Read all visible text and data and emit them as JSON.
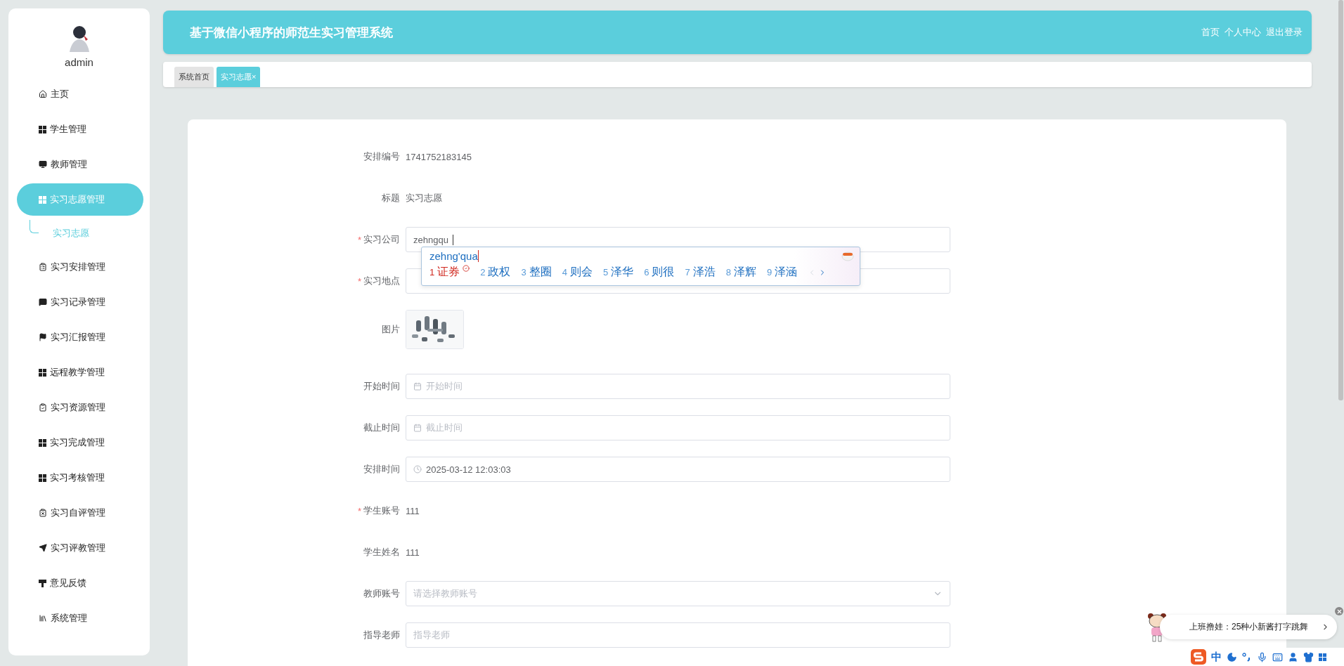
{
  "sidebar": {
    "user": "admin",
    "items": [
      {
        "label": "主页",
        "selected": false
      },
      {
        "label": "学生管理",
        "selected": false
      },
      {
        "label": "教师管理",
        "selected": false
      },
      {
        "label": "实习志愿管理",
        "selected": true,
        "children": [
          {
            "label": "实习志愿",
            "selected": true
          }
        ]
      },
      {
        "label": "实习安排管理",
        "selected": false
      },
      {
        "label": "实习记录管理",
        "selected": false
      },
      {
        "label": "实习汇报管理",
        "selected": false
      },
      {
        "label": "远程教学管理",
        "selected": false
      },
      {
        "label": "实习资源管理",
        "selected": false
      },
      {
        "label": "实习完成管理",
        "selected": false
      },
      {
        "label": "实习考核管理",
        "selected": false
      },
      {
        "label": "实习自评管理",
        "selected": false
      },
      {
        "label": "实习评教管理",
        "selected": false
      },
      {
        "label": "意见反馈",
        "selected": false
      },
      {
        "label": "系统管理",
        "selected": false
      }
    ]
  },
  "header": {
    "title": "基于微信小程序的师范生实习管理系统",
    "links": [
      "首页",
      "个人中心",
      "退出登录"
    ]
  },
  "tabs": [
    {
      "label": "系统首页",
      "selected": false
    },
    {
      "label": "实习志愿",
      "selected": true,
      "close": "×"
    }
  ],
  "form": {
    "fields": [
      {
        "kind": "static",
        "label": "安排编号",
        "value": "1741752183145"
      },
      {
        "kind": "static",
        "label": "标题",
        "value": "实习志愿"
      },
      {
        "kind": "input",
        "label": "实习公司",
        "required_mark": "*",
        "value": "zehngqu",
        "focused": true
      },
      {
        "kind": "input",
        "label": "实习地点",
        "required_mark": "*"
      },
      {
        "label": "图片"
      },
      {
        "kind": "date",
        "label": "开始时间",
        "placeholder": "开始时间"
      },
      {
        "kind": "date",
        "label": "截止时间",
        "placeholder": "截止时间"
      },
      {
        "kind": "datetime",
        "label": "安排时间",
        "value": "2025-03-12 12:03:03"
      },
      {
        "kind": "static",
        "label": "学生账号",
        "required_mark": "*",
        "value": "111"
      },
      {
        "kind": "static",
        "label": "学生姓名",
        "value": "111"
      },
      {
        "kind": "select",
        "label": "教师账号",
        "placeholder": "请选择教师账号"
      },
      {
        "kind": "input",
        "label": "指导老师",
        "placeholder": "指导老师"
      }
    ]
  },
  "ime": {
    "composition": "zehng'qua",
    "candidates": [
      {
        "index": "1",
        "text": "证券",
        "selected": true
      },
      {
        "index": "2",
        "text": "政权",
        "selected": false
      },
      {
        "index": "3",
        "text": "整圈",
        "selected": false
      },
      {
        "index": "4",
        "text": "则会",
        "selected": false
      },
      {
        "index": "5",
        "text": "泽华",
        "selected": false
      },
      {
        "index": "6",
        "text": "则很",
        "selected": false
      },
      {
        "index": "7",
        "text": "泽浩",
        "selected": false
      },
      {
        "index": "8",
        "text": "泽辉",
        "selected": false
      },
      {
        "index": "9",
        "text": "泽涵",
        "selected": false
      }
    ]
  },
  "notification": {
    "text": "上班撸娃：25种小新酱打字跳舞"
  },
  "ime_toolbar": {
    "mode": "中"
  }
}
